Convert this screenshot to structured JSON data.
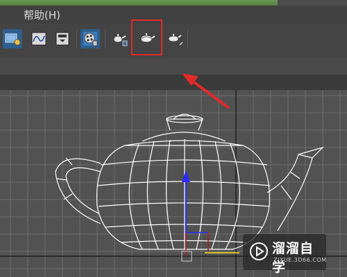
{
  "menu": {
    "help_label": "帮助(H)"
  },
  "toolbar": {
    "buttons": [
      {
        "name": "render-setup-icon"
      },
      {
        "name": "curve-editor-icon"
      },
      {
        "name": "schematic-view-icon"
      },
      {
        "name": "material-editor-icon"
      },
      {
        "name": "render-frame-icon"
      },
      {
        "name": "render-teapot-icon",
        "highlighted": true
      },
      {
        "name": "render-dropdown-icon"
      }
    ],
    "highlight_color": "#e02a2a"
  },
  "viewport": {
    "object": "teapot",
    "wire_color": "#ffffff",
    "grid_color": "#6d6d6d"
  },
  "watermark": {
    "title": "溜溜自学",
    "subtitle": "ZIXUE.3D66.COM"
  }
}
